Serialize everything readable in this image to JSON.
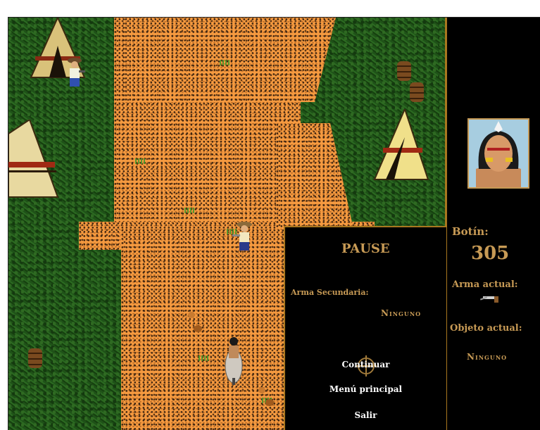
{
  "pause_menu": {
    "title": "PAUSE",
    "secondary_weapon_label": "Arma Secundaria:",
    "secondary_weapon_value": "Ninguno",
    "items": [
      {
        "label": "Continuar"
      },
      {
        "label": "Menú principal"
      },
      {
        "label": "Salir"
      }
    ]
  },
  "hud": {
    "loot_label": "Botín:",
    "loot_value": "305",
    "current_weapon_label": "Arma actual:",
    "current_weapon_icon": "revolver-icon",
    "current_item_label": "Objeto actual:",
    "current_item_value": "Ninguno"
  },
  "colors": {
    "gold": "#c79a55",
    "trail": "#f59a40",
    "grass": "#1f5218",
    "border": "#a9771f"
  }
}
